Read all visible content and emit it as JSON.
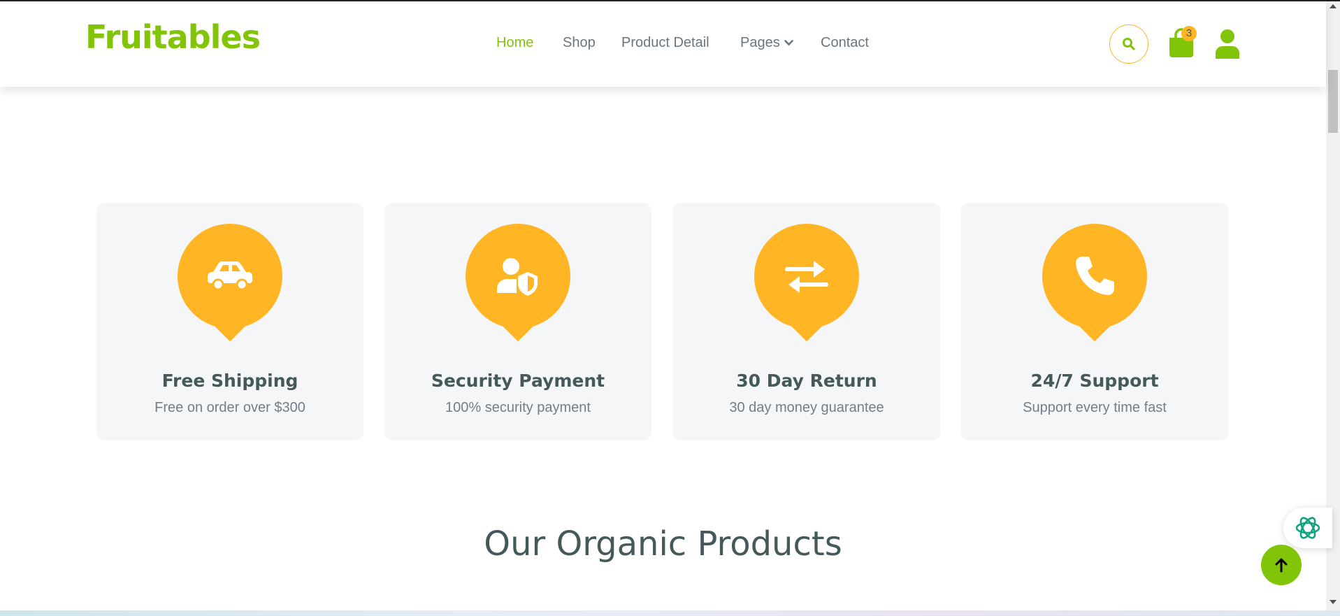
{
  "brand": {
    "name": "Fruitables",
    "color": "#81c408"
  },
  "nav": {
    "items": [
      {
        "label": "Home",
        "active": true
      },
      {
        "label": "Shop",
        "active": false
      },
      {
        "label": "Product Detail",
        "active": false
      },
      {
        "label": "Pages",
        "active": false,
        "dropdown": true
      },
      {
        "label": "Contact",
        "active": false
      }
    ],
    "cart_count": "3",
    "icons": [
      "search-icon",
      "shopping-bag-icon",
      "user-icon"
    ]
  },
  "features": [
    {
      "icon": "car-icon",
      "title": "Free Shipping",
      "subtitle": "Free on order over $300"
    },
    {
      "icon": "user-shield-icon",
      "title": "Security Payment",
      "subtitle": "100% security payment"
    },
    {
      "icon": "exchange-icon",
      "title": "30 Day Return",
      "subtitle": "30 day money guarantee"
    },
    {
      "icon": "phone-icon",
      "title": "24/7 Support",
      "subtitle": "Support every time fast"
    }
  ],
  "section": {
    "title": "Our Organic Products"
  },
  "colors": {
    "primary": "#81c408",
    "secondary": "#ffb524",
    "text_dark": "#45595b",
    "text_muted": "#747d88",
    "card_bg": "#f4f6f8"
  }
}
